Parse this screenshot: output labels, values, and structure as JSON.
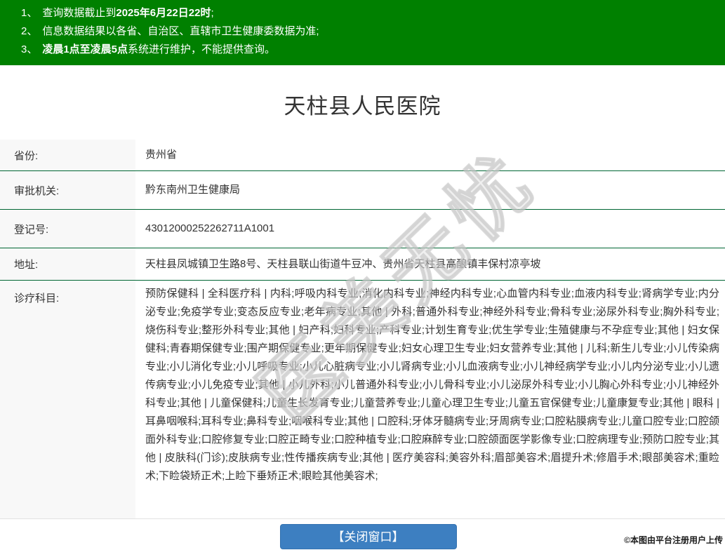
{
  "banner": {
    "bg_color": "#008000",
    "notices": [
      {
        "num": "1、",
        "pre": "查询数据截止到",
        "bold": "2025年6月22日22时",
        "post": ";"
      },
      {
        "num": "2、",
        "pre": "信息数据结果以各省、自治区、直辖市卫生健康委数据为准;",
        "bold": "",
        "post": ""
      },
      {
        "num": "3、",
        "pre": "",
        "bold": "凌晨1点至凌晨5点",
        "post": "系统进行维护，不能提供查询。"
      }
    ]
  },
  "title": "天柱县人民医院",
  "info": {
    "rows": [
      {
        "label": "省份:",
        "value": "贵州省"
      },
      {
        "label": "审批机关:",
        "value": "黔东南州卫生健康局"
      },
      {
        "label": "登记号:",
        "value": "43012000252262711A1001"
      },
      {
        "label": "地址:",
        "value": "天柱县凤城镇卫生路8号、天柱县联山街道牛豆冲、贵州省天柱县高酿镇丰保村凉亭坡"
      },
      {
        "label": "诊疗科目:",
        "value": "预防保健科 | 全科医疗科 | 内科;呼吸内科专业;消化内科专业;神经内科专业;心血管内科专业;血液内科专业;肾病学专业;内分泌专业;免疫学专业;变态反应专业;老年病专业;其他 | 外科;普通外科专业;神经外科专业;骨科专业;泌尿外科专业;胸外科专业;烧伤科专业;整形外科专业;其他 | 妇产科;妇科专业;产科专业;计划生育专业;优生学专业;生殖健康与不孕症专业;其他 | 妇女保健科;青春期保健专业;围产期保健专业;更年期保健专业;妇女心理卫生专业;妇女营养专业;其他 | 儿科;新生儿专业;小儿传染病专业;小儿消化专业;小儿呼吸专业;小儿心脏病专业;小儿肾病专业;小儿血液病专业;小儿神经病学专业;小儿内分泌专业;小儿遗传病专业;小儿免疫专业;其他 | 小儿外科;小儿普通外科专业;小儿骨科专业;小儿泌尿外科专业;小儿胸心外科专业;小儿神经外科专业;其他 | 儿童保健科;儿童生长发育专业;儿童营养专业;儿童心理卫生专业;儿童五官保健专业;儿童康复专业;其他 | 眼科 | 耳鼻咽喉科;耳科专业;鼻科专业;咽喉科专业;其他 | 口腔科;牙体牙髓病专业;牙周病专业;口腔粘膜病专业;儿童口腔专业;口腔颌面外科专业;口腔修复专业;口腔正畸专业;口腔种植专业;口腔麻醉专业;口腔颌面医学影像专业;口腔病理专业;预防口腔专业;其他 | 皮肤科(门诊);皮肤病专业;性传播疾病专业;其他 | 医疗美容科;美容外科;眉部美容术;眉提升术;修眉手术;眼部美容术;重睑术;下睑袋矫正术;上睑下垂矫正术;眼睑其他美容术;"
      }
    ]
  },
  "watermark_text": "医美无忧",
  "footer": {
    "close_button_label": "【关闭窗口】",
    "copyright": "©本图由平台注册用户上传"
  },
  "colors": {
    "banner_green": "#008000",
    "row_border_green": "#006633",
    "label_bg": "#f8f8f8",
    "button_blue": "#3d7fc1",
    "text": "#333333"
  }
}
